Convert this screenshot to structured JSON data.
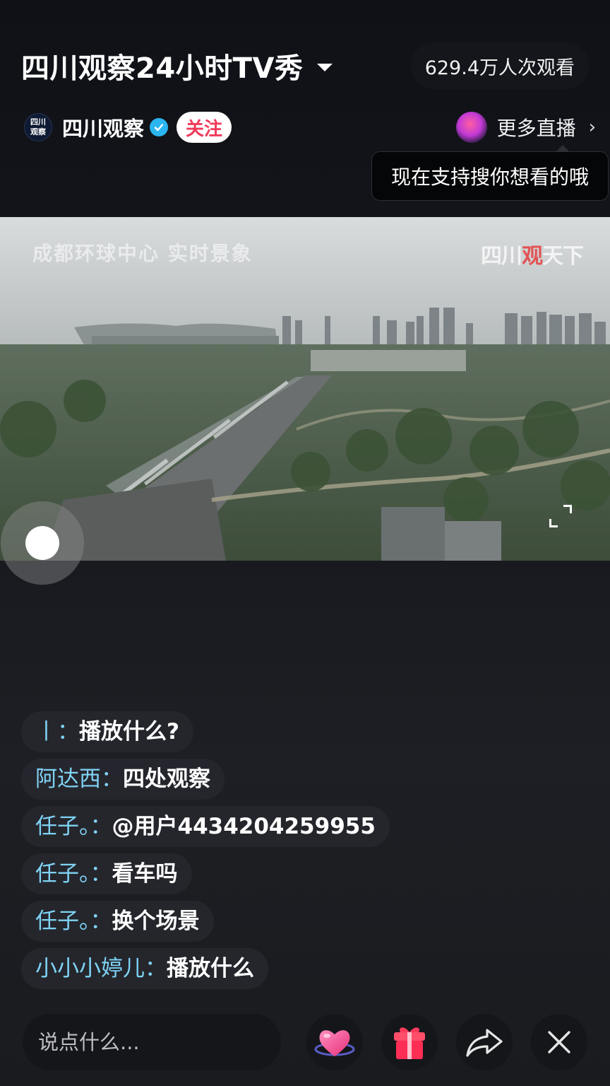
{
  "header": {
    "title": "四川观察24小时TV秀",
    "viewer_count": "629.4万人次观看"
  },
  "host": {
    "avatar_text_top": "四川",
    "avatar_text_bottom": "观察",
    "name": "四川观察",
    "follow_label": "关注"
  },
  "more_live": {
    "label": "更多直播",
    "tooltip": "现在支持搜你想看的哦"
  },
  "video": {
    "caption": "成都环球中心 实时景象",
    "watermark_prefix": "四川",
    "watermark_highlight": "观",
    "watermark_suffix": "天下"
  },
  "chat": [
    {
      "user": "丨：",
      "text": "播放什么?"
    },
    {
      "user": "阿达西：",
      "text": "四处观察"
    },
    {
      "user": "任子。：",
      "text": "@用户4434204259955"
    },
    {
      "user": "任子。：",
      "text": "看车吗"
    },
    {
      "user": "任子。：",
      "text": "换个场景"
    },
    {
      "user": "小小小婷儿：",
      "text": "播放什么"
    }
  ],
  "bottom_bar": {
    "comment_placeholder": "说点什么..."
  },
  "icons": {
    "verified": "verified-check-icon",
    "like": "heart-like-icon",
    "gift": "gift-icon",
    "share": "share-arrow-icon",
    "close": "close-icon"
  },
  "colors": {
    "follow_text": "#f03a5a",
    "chat_user": "#7fd3f5",
    "verified": "#2bb5f0"
  }
}
